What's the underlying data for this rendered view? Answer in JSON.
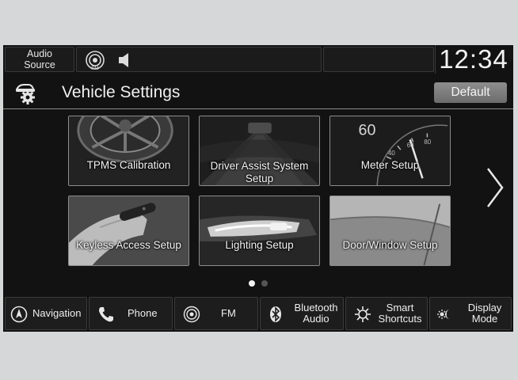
{
  "topbar": {
    "audio_source": "Audio\nSource",
    "audio_source_line1": "Audio",
    "audio_source_line2": "Source",
    "fm_badge": "FM",
    "clock": "12:34"
  },
  "header": {
    "title": "Vehicle Settings",
    "default_label": "Default"
  },
  "tiles": [
    {
      "label": "TPMS Calibration"
    },
    {
      "label_line1": "Driver Assist System",
      "label_line2": "Setup"
    },
    {
      "label": "Meter Setup",
      "gauge_speed": "60",
      "gauge_ticks": [
        "40",
        "60",
        "80"
      ]
    },
    {
      "label": "Keyless Access Setup"
    },
    {
      "label": "Lighting Setup"
    },
    {
      "label": "Door/Window Setup"
    }
  ],
  "pager": {
    "pages": 2,
    "current": 1
  },
  "bottombar": {
    "navigation": "Navigation",
    "phone": "Phone",
    "fm": "FM",
    "bluetooth_line1": "Bluetooth",
    "bluetooth_line2": "Audio",
    "smart_line1": "Smart",
    "smart_line2": "Shortcuts",
    "display_line1": "Display",
    "display_line2": "Mode"
  },
  "icons": [
    "fm-signal-icon",
    "speaker-icon",
    "vehicle-settings-gear-icon",
    "chevron-right-icon",
    "navigation-compass-icon",
    "phone-handset-icon",
    "fm-radio-icon",
    "bluetooth-icon",
    "smart-shortcuts-icon",
    "display-mode-icon"
  ]
}
